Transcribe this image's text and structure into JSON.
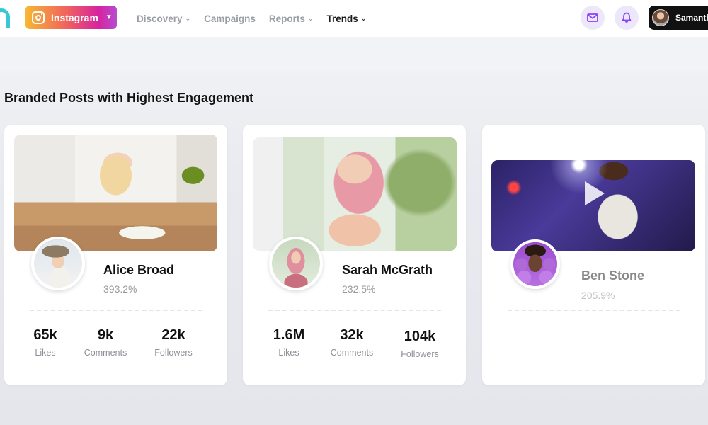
{
  "nav": {
    "platform_label": "Instagram",
    "items": [
      {
        "label": "Discovery",
        "has_dropdown": true
      },
      {
        "label": "Campaigns",
        "has_dropdown": false
      },
      {
        "label": "Reports",
        "has_dropdown": true
      },
      {
        "label": "Trends",
        "has_dropdown": true,
        "active": true
      }
    ],
    "user_name": "Samanth",
    "icons": {
      "mail": "mail-icon",
      "bell": "bell-icon"
    }
  },
  "section": {
    "title": "Branded Posts with Highest Engagement"
  },
  "cards": [
    {
      "name": "Alice Broad",
      "engagement": "393.2%",
      "stats": [
        {
          "value": "65k",
          "label": "Likes"
        },
        {
          "value": "9k",
          "label": "Comments"
        },
        {
          "value": "22k",
          "label": "Followers"
        }
      ]
    },
    {
      "name": "Sarah McGrath",
      "engagement": "232.5%",
      "stats": [
        {
          "value": "1.6M",
          "label": "Likes"
        },
        {
          "value": "32k",
          "label": "Comments"
        },
        {
          "value": "104k",
          "label": "Followers"
        }
      ]
    },
    {
      "name": "Ben Stone",
      "engagement": "205.9%",
      "media_type": "video"
    }
  ],
  "colors": {
    "accent": "#8a3ffc",
    "brand": "#39c6d6"
  }
}
